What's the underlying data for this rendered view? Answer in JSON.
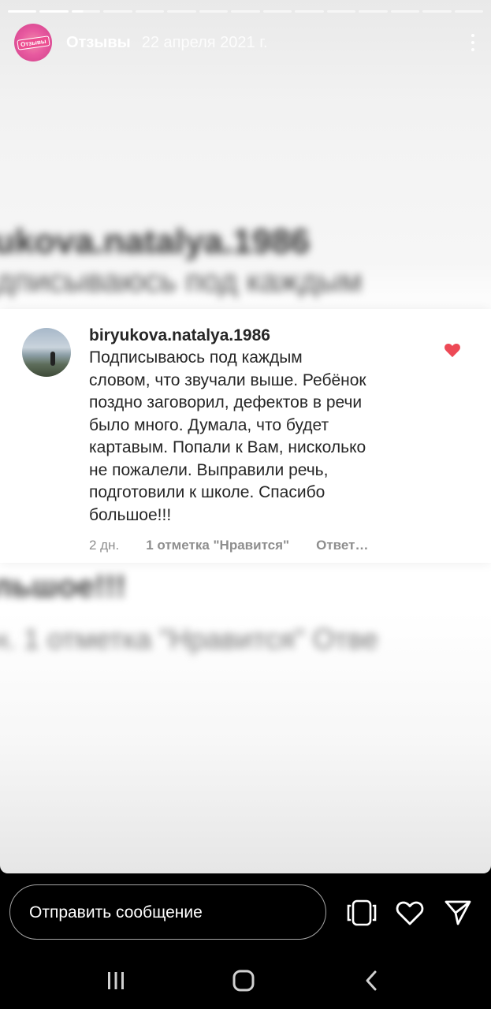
{
  "story": {
    "account_name": "Отзывы",
    "date": "22 апреля 2021 г.",
    "avatar_badge": "Отзывы",
    "progress_segments": 15,
    "progress_current_index": 2
  },
  "background_blur": {
    "line1": "ukova.natalya.1986",
    "line2": "дписываюсь под каждым",
    "line3": "льшое!!!",
    "line4": "н.     1 отметка \"Нравится\"      Отве"
  },
  "comment": {
    "username": "biryukova.natalya.1986",
    "text": "Подписываюсь под каждым\nсловом, что звучали выше. Ребёнок\nпоздно заговорил, дефектов в речи\nбыло много. Думала, что будет\nкартавым. Попали к Вам, нисколько\nне пожалели. Выправили речь,\nподготовили к школе. Спасибо\nбольшое!!!",
    "time": "2 дн.",
    "likes": "1 отметка \"Нравится\"",
    "reply": "Ответ…",
    "liked": true,
    "heart_color": "#ed4956"
  },
  "reply_bar": {
    "placeholder": "Отправить сообщение"
  },
  "icons": [
    "more-icon",
    "sticker-icon",
    "heart-icon",
    "send-icon",
    "recent-apps-icon",
    "home-icon",
    "back-icon"
  ]
}
